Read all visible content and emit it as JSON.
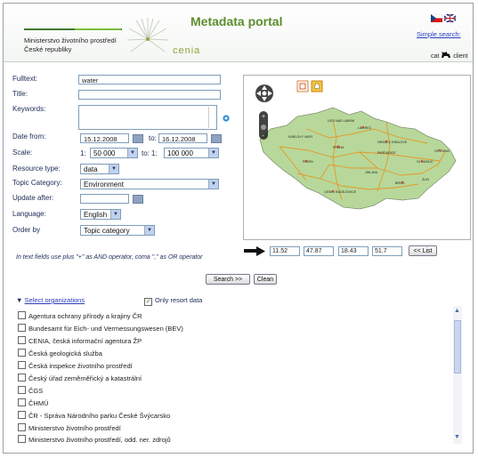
{
  "header": {
    "ministry_line1": "Ministerstvo životního prostředí",
    "ministry_line2": "České republiky",
    "logo_text": "cenia",
    "title": "Metadata portal",
    "simple_search": "Simple search:",
    "cat_label": "cat",
    "client_label": "client"
  },
  "form": {
    "fulltext_label": "Fulltext:",
    "fulltext_value": "water",
    "title_label": "Title:",
    "title_value": "",
    "keywords_label": "Keywords:",
    "keywords_value": "",
    "date_from_label": "Date from:",
    "date_from_value": "15.12.2008",
    "date_to_label": "to:",
    "date_to_value": "16.12.2008",
    "scale_label": "Scale:",
    "scale_from_prefix": "1:",
    "scale_from_value": "50 000",
    "scale_to_label": "to: 1:",
    "scale_to_value": "100 000",
    "resource_type_label": "Resource type:",
    "resource_type_value": "data",
    "topic_label": "Topic Category:",
    "topic_value": "Environment",
    "update_label": "Update after:",
    "update_value": "",
    "language_label": "Language:",
    "language_value": "English",
    "order_label": "Order by",
    "order_value": "Topic category",
    "hint": "In text fields use plus \"+\" as AND operator, coma \",\" as OR operator"
  },
  "map": {
    "cities": [
      "KARLOVY VARY",
      "PRAHA",
      "LIBEREC",
      "HRADEC KRALOVE",
      "PARDUBICE",
      "PLZEN",
      "JIHLAVA",
      "BRNO",
      "OLOMOUC",
      "OSTRAVA",
      "ZLIN",
      "CESKE BUDEJOVICE",
      "USTI NAD LABEM"
    ]
  },
  "bbox": {
    "x1": "11.52",
    "y1": "47.87",
    "x2": "18.43",
    "y2": "51.7",
    "list_button": "<< List"
  },
  "buttons": {
    "search": "Search >>",
    "clean": "Clean"
  },
  "organizations": {
    "toggle_label": "Select organizations",
    "only_resort_label": "Only resort data",
    "items": [
      "Agentura ochrany přírody a krajiny ČR",
      "Bundesamt für Eich- und Vermessungswesen (BEV)",
      "CENIA, česká informační agentura ŽP",
      "Česká geologická služba",
      "Česká inspekce životního prostředí",
      "Český úřad zeměměřický a katastrální",
      "ČGS",
      "ČHMÚ",
      "ČR - Správa Národního parku České Švýcarsko",
      "Ministerstvo životního prostředí",
      "Ministerstvo životního prostředí, odd. ner. zdrojů"
    ]
  },
  "colors": {
    "title_green": "#5d8c2c",
    "map_green": "#b7d89a",
    "road_orange": "#e8921c",
    "link_blue": "#2a3bbf"
  }
}
